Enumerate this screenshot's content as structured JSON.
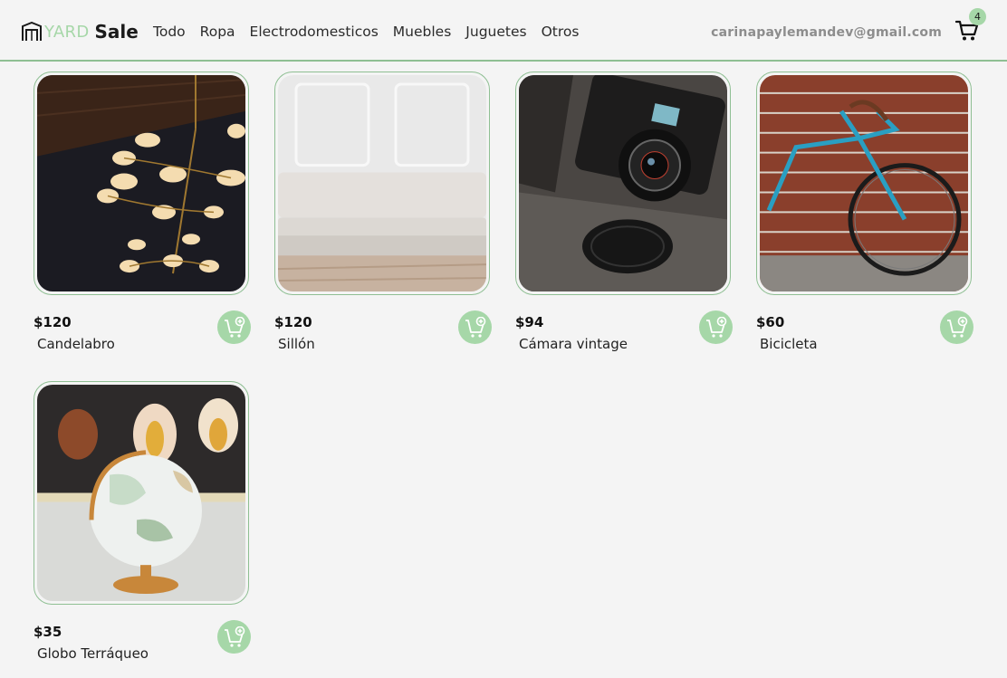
{
  "brand": {
    "logo_icon": "storefront-icon",
    "yard": "YARD",
    "sale": "Sale"
  },
  "nav": {
    "links": [
      "Todo",
      "Ropa",
      "Electrodomesticos",
      "Muebles",
      "Juguetes",
      "Otros"
    ]
  },
  "user": {
    "email": "carinapaylemandev@gmail.com"
  },
  "cart": {
    "icon": "shopping-cart-icon",
    "count": "4"
  },
  "colors": {
    "accent": "#a6d7a8",
    "border": "#8fbf93",
    "background": "#f4f4f4"
  },
  "products": [
    {
      "price": "$120",
      "name": "Candelabro",
      "image": "chandelier-photo",
      "add_icon": "add-to-cart-icon"
    },
    {
      "price": "$120",
      "name": "Sillón",
      "image": "white-sofa-photo",
      "add_icon": "add-to-cart-icon"
    },
    {
      "price": "$94",
      "name": "Cámara vintage",
      "image": "vintage-camera-photo",
      "add_icon": "add-to-cart-icon"
    },
    {
      "price": "$60",
      "name": "Bicicleta",
      "image": "bicycle-photo",
      "add_icon": "add-to-cart-icon"
    },
    {
      "price": "$35",
      "name": "Globo Terráqueo",
      "image": "globe-photo",
      "add_icon": "add-to-cart-icon"
    }
  ]
}
